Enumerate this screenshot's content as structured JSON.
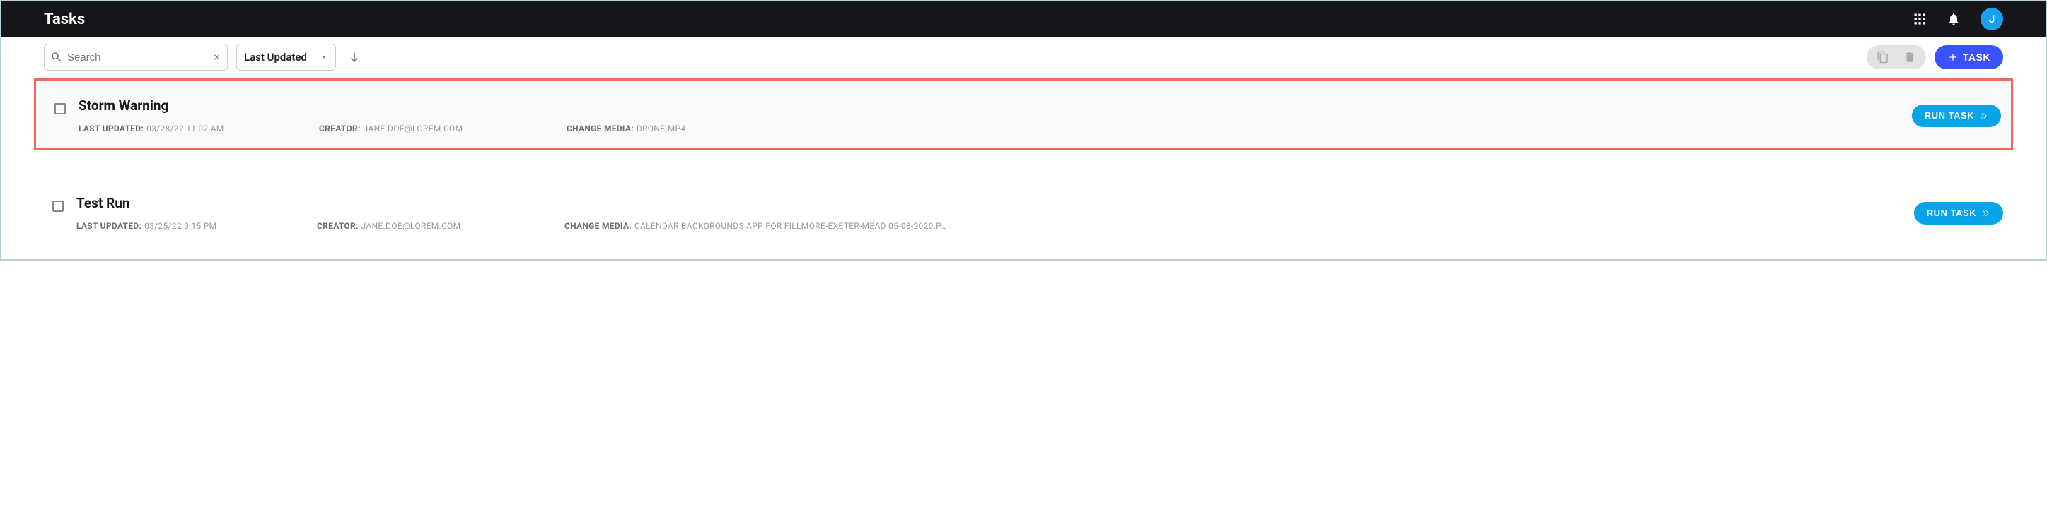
{
  "header": {
    "title": "Tasks",
    "avatar_initial": "J"
  },
  "toolbar": {
    "search_placeholder": "Search",
    "sort_label": "Last Updated",
    "add_task_label": "TASK"
  },
  "labels": {
    "last_updated": "LAST UPDATED:",
    "creator": "CREATOR:",
    "change_media": "CHANGE MEDIA:",
    "run_task": "RUN TASK"
  },
  "tasks": [
    {
      "title": "Storm Warning",
      "last_updated": "03/28/22 11:02 AM",
      "creator": "JANE.DOE@LOREM.COM",
      "change_media": "DRONE.MP4",
      "highlighted": true
    },
    {
      "title": "Test Run",
      "last_updated": "03/25/22 3:15 PM",
      "creator": "JANE.DOE@LOREM.COM",
      "change_media": "CALENDAR BACKGROUNDS APP FOR FILLMORE-EXETER-MEAD 05-08-2020.P…",
      "highlighted": false
    }
  ]
}
